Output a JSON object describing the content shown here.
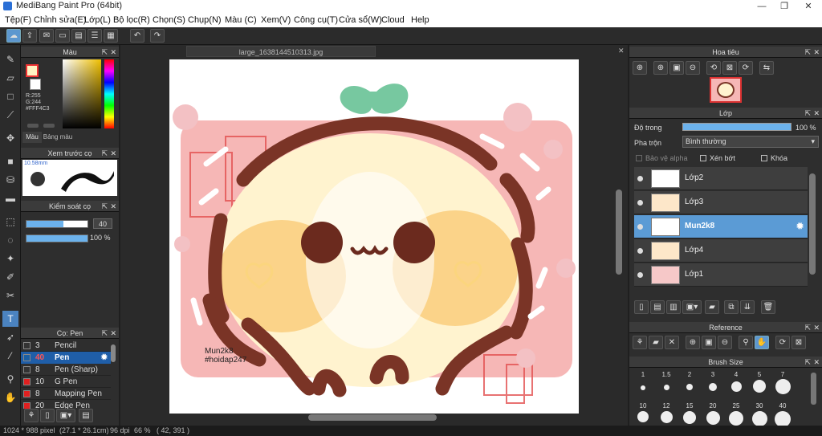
{
  "window": {
    "title": "MediBang Paint Pro (64bit)",
    "min": "—",
    "max": "❐",
    "close": "✕"
  },
  "menu": [
    "Tệp(F)",
    "Chỉnh sửa(E)",
    "Lớp(L)",
    "Bộ lọc(R)",
    "Chọn(S)",
    "Chụp(N)",
    "Màu (C)",
    "Xem(V)",
    "Công cụ(T)",
    "Cửa sổ(W)",
    "Cloud",
    "Help"
  ],
  "toolbar": {
    "undo": "↶",
    "redo": "↷"
  },
  "color_panel": {
    "title": "Màu",
    "r": "R:255",
    "g": "G:244",
    "hex": "#FFF4C3",
    "tab_color": "Màu",
    "tab_palette": "Bảng màu",
    "fg_color": "#FFF4C3",
    "bg_color": "#ffffff"
  },
  "brush_preview": {
    "title": "Xem trước cọ",
    "size": "10.58mm"
  },
  "brush_control": {
    "title": "Kiểm soát cọ",
    "size_value": "40",
    "opacity_value": "100 %"
  },
  "brush_list": {
    "title": "Cọ: Pen",
    "items": [
      {
        "size": "3",
        "name": "Pencil",
        "color": "#333333"
      },
      {
        "size": "40",
        "name": "Pen",
        "color": "#1b5fa3",
        "selected": true
      },
      {
        "size": "8",
        "name": "Pen (Sharp)",
        "color": "#333333"
      },
      {
        "size": "10",
        "name": "G Pen",
        "color": "#e02020"
      },
      {
        "size": "8",
        "name": "Mapping Pen",
        "color": "#e02020"
      },
      {
        "size": "20",
        "name": "Edge Pen",
        "color": "#e02020"
      }
    ]
  },
  "document": {
    "tab": "large_1638144510313.jpg",
    "watermark_line1": "Mun2k8",
    "watermark_line2": "#hoidap247"
  },
  "navigator": {
    "title": "Hoa tiêu"
  },
  "layer_panel": {
    "title": "Lớp",
    "opacity_label": "Độ trong",
    "opacity_value": "100 %",
    "blend_label": "Pha trộn",
    "blend_value": "Bình thường",
    "alpha_label": "Bảo vệ alpha",
    "clip_label": "Xén bớt",
    "lock_label": "Khóa",
    "layers": [
      {
        "name": "Lớp2"
      },
      {
        "name": "Lớp3"
      },
      {
        "name": "Mun2k8",
        "selected": true
      },
      {
        "name": "Lớp4"
      },
      {
        "name": "Lớp1"
      }
    ]
  },
  "reference": {
    "title": "Reference"
  },
  "brush_size": {
    "title": "Brush Size",
    "row1": [
      "1",
      "1.5",
      "2",
      "3",
      "4",
      "5",
      "7"
    ],
    "row2": [
      "10",
      "12",
      "15",
      "20",
      "25",
      "30",
      "40"
    ]
  },
  "status": {
    "dimensions": "1024 * 988 pixel",
    "physical": "(27.1 * 26.1cm)",
    "dpi": "96 dpi",
    "zoom": "66 %",
    "cursor": "( 42, 391 )"
  }
}
